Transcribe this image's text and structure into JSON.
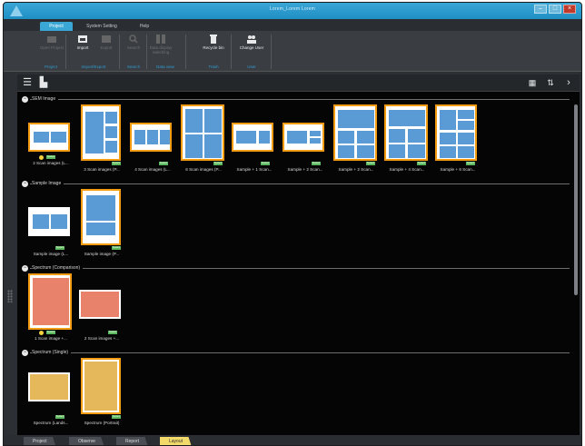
{
  "window": {
    "title": "Lorem_Lorem Lorem"
  },
  "ribbon_tabs": [
    "Project",
    "System Setting",
    "Help"
  ],
  "ribbon": {
    "buttons": [
      {
        "label": "Open Project",
        "icon": "folder-icon",
        "enabled": false
      },
      {
        "label": "Import",
        "icon": "import-icon",
        "enabled": true
      },
      {
        "label": "Export",
        "icon": "export-icon",
        "enabled": false
      },
      {
        "label": "Search",
        "icon": "search-icon",
        "enabled": false
      },
      {
        "label": "Data display switching",
        "icon": "switch-icon",
        "enabled": false
      },
      {
        "label": "Recycle bin",
        "icon": "trash-icon",
        "enabled": true
      },
      {
        "label": "Change User",
        "icon": "users-icon",
        "enabled": true
      }
    ],
    "groups": [
      "Project",
      "Import/Export",
      "Search",
      "Data view",
      "Trash",
      "User"
    ]
  },
  "sections": [
    {
      "title": "SEM Image",
      "items": [
        {
          "label": "2 Scan images (L...",
          "tag": "System"
        },
        {
          "label": "3 Scan images (P...",
          "tag": "System"
        },
        {
          "label": "4 Scan images (L...",
          "tag": "System"
        },
        {
          "label": "6 Scan images (P...",
          "tag": "System"
        },
        {
          "label": "Sample + 1 Scan...",
          "tag": "System"
        },
        {
          "label": "Sample + 2 Scan...",
          "tag": "System"
        },
        {
          "label": "Sample + 2 Scan...",
          "tag": "System"
        },
        {
          "label": "Sample + 4 Scan...",
          "tag": "System"
        },
        {
          "label": "Sample + 6 Scan...",
          "tag": "System"
        }
      ]
    },
    {
      "title": "Sample Image",
      "items": [
        {
          "label": "Sample image (L...",
          "tag": "System"
        },
        {
          "label": "Sample image (P...",
          "tag": "System"
        }
      ]
    },
    {
      "title": "Spectrum (Comparison)",
      "items": [
        {
          "label": "1 Scan image +...",
          "tag": "System"
        },
        {
          "label": "2 Scan images +...",
          "tag": "System"
        }
      ]
    },
    {
      "title": "Spectrum (Single)",
      "items": [
        {
          "label": "Spectrum (Lands...",
          "tag": "System"
        },
        {
          "label": "Spectrum (Portrait)",
          "tag": "System"
        }
      ]
    }
  ],
  "bottom_tabs": [
    "Project",
    "Observe",
    "Report",
    "Layout"
  ],
  "colors": {
    "accent": "#3aa6d6",
    "selection": "#f39c12",
    "tag": "#5cb85c",
    "active_tab": "#f1d96a"
  }
}
